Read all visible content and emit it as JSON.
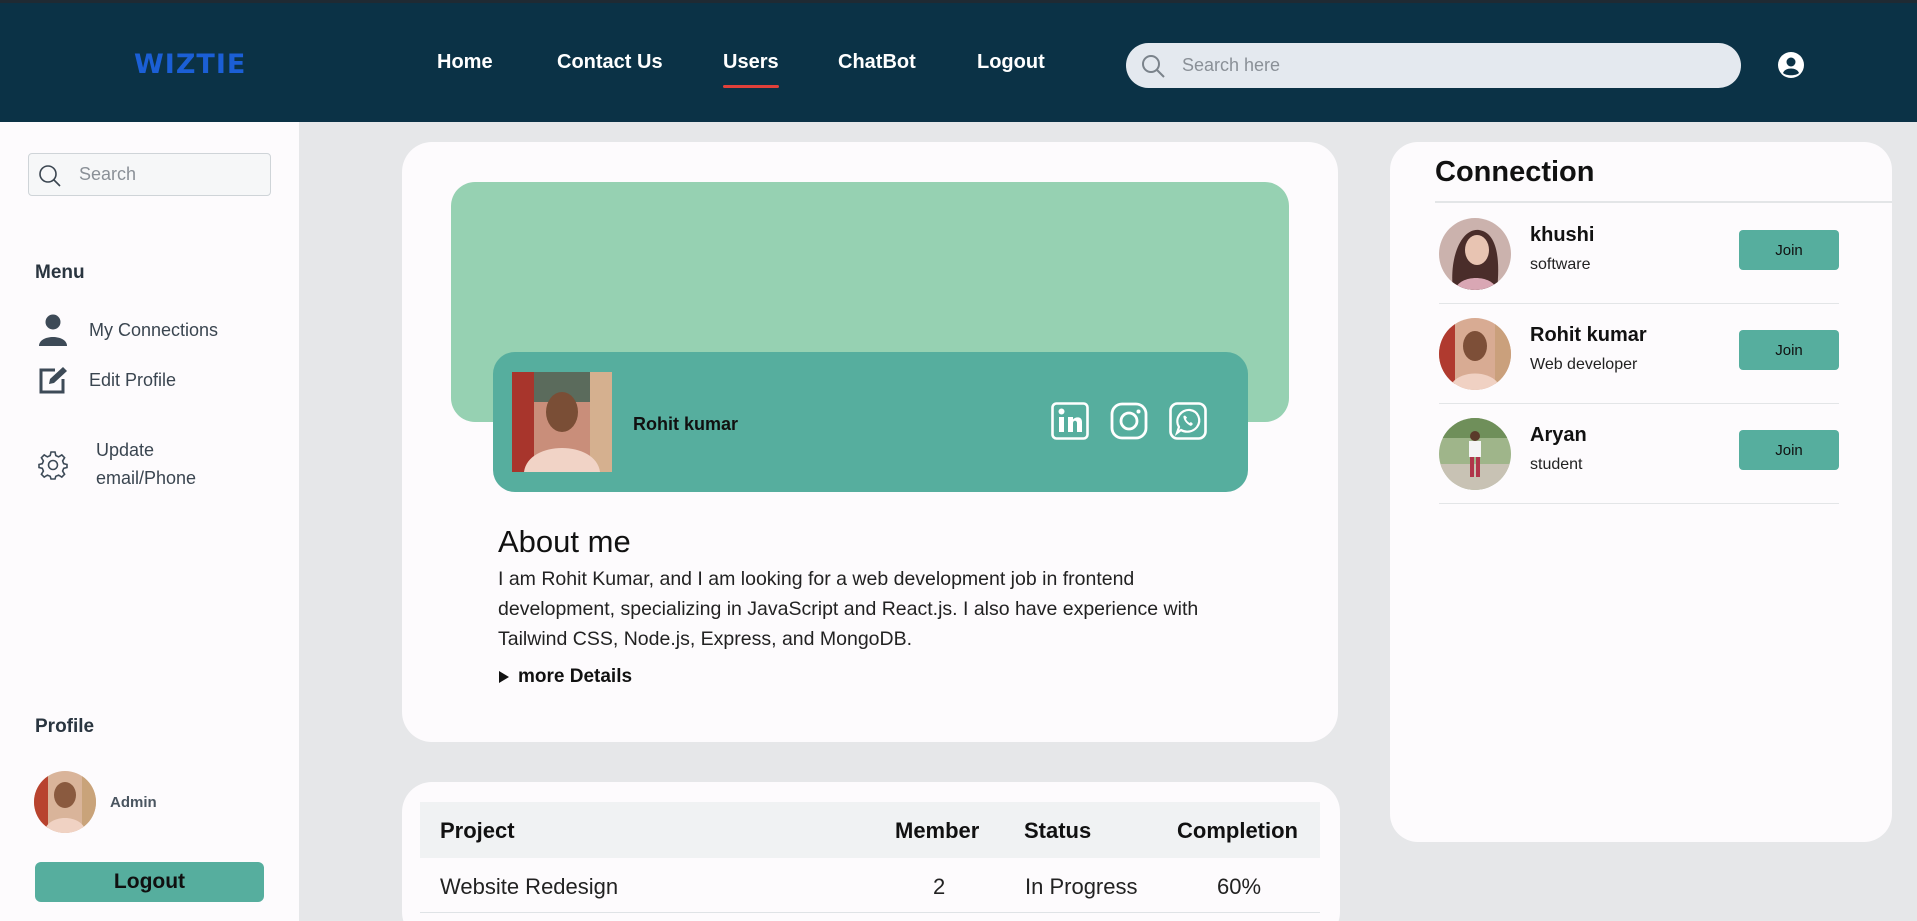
{
  "header": {
    "logo": "WIZTIE",
    "nav": [
      {
        "label": "Home"
      },
      {
        "label": "Contact Us"
      },
      {
        "label": "Users",
        "active": true
      },
      {
        "label": "ChatBot"
      },
      {
        "label": "Logout"
      }
    ],
    "search_placeholder": "Search here",
    "user_icon": "user-circle-icon",
    "colors": {
      "background": "#0b3246",
      "logo": "#1b5fd6",
      "active_underline": "#e0403a"
    }
  },
  "sidebar": {
    "search_placeholder": "Search",
    "menu_heading": "Menu",
    "menu": [
      {
        "label": "My Connections",
        "icon": "person-icon"
      },
      {
        "label": "Edit Profile",
        "icon": "edit-icon"
      },
      {
        "label": "Update email/Phone",
        "icon": "gear-icon"
      }
    ],
    "profile_heading": "Profile",
    "profile_name": "Admin",
    "logout_label": "Logout"
  },
  "profile": {
    "name": "Rohit kumar",
    "social": [
      "linkedin-icon",
      "instagram-icon",
      "whatsapp-icon"
    ],
    "about_title": "About me",
    "about_text": "I am Rohit Kumar, and I am looking for a web development job in frontend development, specializing in JavaScript and React.js. I also have experience with Tailwind CSS, Node.js, Express, and MongoDB.",
    "more_label": "more Details",
    "colors": {
      "banner": "#96d1b2",
      "accent": "#56ae9e"
    }
  },
  "projects": {
    "headers": [
      "Project",
      "Member",
      "Status",
      "Completion"
    ],
    "rows": [
      {
        "project": "Website Redesign",
        "member": "2",
        "status": "In Progress",
        "completion": "60%"
      }
    ]
  },
  "connections": {
    "title": "Connection",
    "join_label": "Join",
    "items": [
      {
        "name": "khushi",
        "role": "software"
      },
      {
        "name": "Rohit kumar",
        "role": "Web developer"
      },
      {
        "name": "Aryan",
        "role": "student"
      }
    ]
  }
}
